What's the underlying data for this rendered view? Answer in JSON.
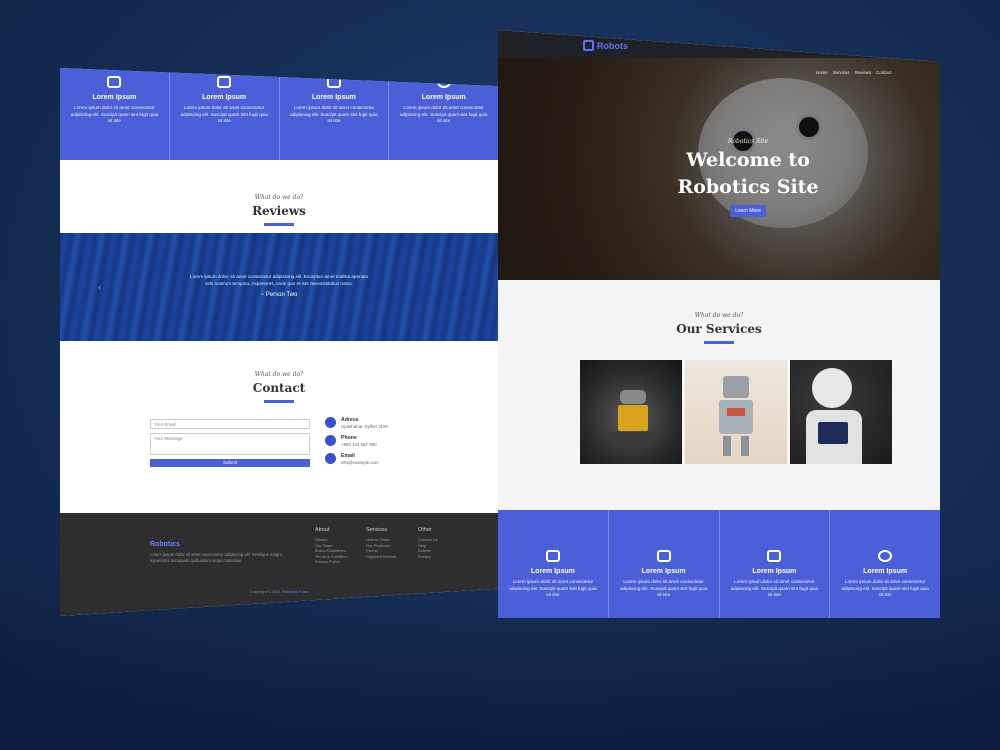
{
  "left_page": {
    "features": [
      {
        "title": "Lorem Ipsum",
        "icon": "robot-icon",
        "desc": "Lorem ipsum dolor sit amet consectetur adipiscing elit. Suscipit quam sint fugit quia sit iste"
      },
      {
        "title": "Lorem Ipsum",
        "icon": "laptop-icon",
        "desc": "Lorem ipsum dolor sit amet consectetur adipiscing elit. Suscipit quam sint fugit quia sit iste"
      },
      {
        "title": "Lorem Ipsum",
        "icon": "chip-icon",
        "desc": "Lorem ipsum dolor sit amet consectetur adipiscing elit. Suscipit quam sint fugit quia sit iste"
      },
      {
        "title": "Lorem Ipsum",
        "icon": "chat-icon",
        "desc": "Lorem ipsum dolor sit amet consectetur adipiscing elit. Suscipit quam sint fugit quia sit iste"
      }
    ],
    "reviews": {
      "script": "What do we do?",
      "title": "Reviews",
      "quote": "Lorem ipsum dolor, sit amet consectetur adipisicing elit. Excepturi amet mollitia aperiam velit nostrum tempora. Asperiores, unde quo et iste necessitatibus natus.",
      "author": "~ Person Two"
    },
    "contact": {
      "script": "What do we do?",
      "title": "Contact",
      "email_placeholder": "Your Email",
      "message_placeholder": "Your Message",
      "submit_label": "Submit",
      "info": [
        {
          "label": "Adress",
          "value": "Upashahar, Sylhet 3100",
          "icon": "location-pin-icon"
        },
        {
          "label": "Phone",
          "value": "+880 124 567 890",
          "icon": "phone-icon"
        },
        {
          "label": "Email",
          "value": "info@example.com",
          "icon": "envelope-icon"
        }
      ]
    },
    "footer": {
      "brand": "Robotics",
      "brand_text": "Lorem ipsum dolor sit amet consectetur adipiscing elit. Similique magni asperiores numquam quibusdam sequi molestias.",
      "columns": [
        {
          "heading": "About",
          "items": [
            "History",
            "Our Team",
            "Brand Guidelines",
            "Terms & Condition",
            "Privacy Policy"
          ]
        },
        {
          "heading": "Services",
          "items": [
            "How to Order",
            "Our Products",
            "Promo",
            "Payment Method"
          ]
        },
        {
          "heading": "Other",
          "items": [
            "Contact Us",
            "Help",
            "Submit",
            "Privacy"
          ]
        }
      ],
      "copyright": "Copyright © 2021",
      "copyright_brand": "Robotics Team"
    }
  },
  "right_page": {
    "logo": "Robots",
    "menu": [
      "Home",
      "Services",
      "Reviews",
      "Contact"
    ],
    "hero": {
      "script": "Robotics Site",
      "title_line1": "Welcome to",
      "title_line2": "Robotics Site",
      "button": "Learn More"
    },
    "services": {
      "script": "What do we do?",
      "title": "Our Services"
    },
    "features": [
      {
        "title": "Lorem Ipsum",
        "icon": "robot-icon",
        "desc": "Lorem ipsum dolor sit amet consectetur adipiscing elit. Suscipit quam sint fugit quia sit iste"
      },
      {
        "title": "Lorem Ipsum",
        "icon": "laptop-icon",
        "desc": "Lorem ipsum dolor sit amet consectetur adipiscing elit. Suscipit quam sint fugit quia sit iste"
      },
      {
        "title": "Lorem Ipsum",
        "icon": "chip-icon",
        "desc": "Lorem ipsum dolor sit amet consectetur adipiscing elit. Suscipit quam sint fugit quia sit iste"
      },
      {
        "title": "Lorem Ipsum",
        "icon": "chat-icon",
        "desc": "Lorem ipsum dolor sit amet consectetur adipiscing elit. Suscipit quam sint fugit quia sit iste"
      }
    ]
  },
  "colors": {
    "accent": "#4a5fd8",
    "background": "#173059",
    "footer": "#2e2e30"
  }
}
